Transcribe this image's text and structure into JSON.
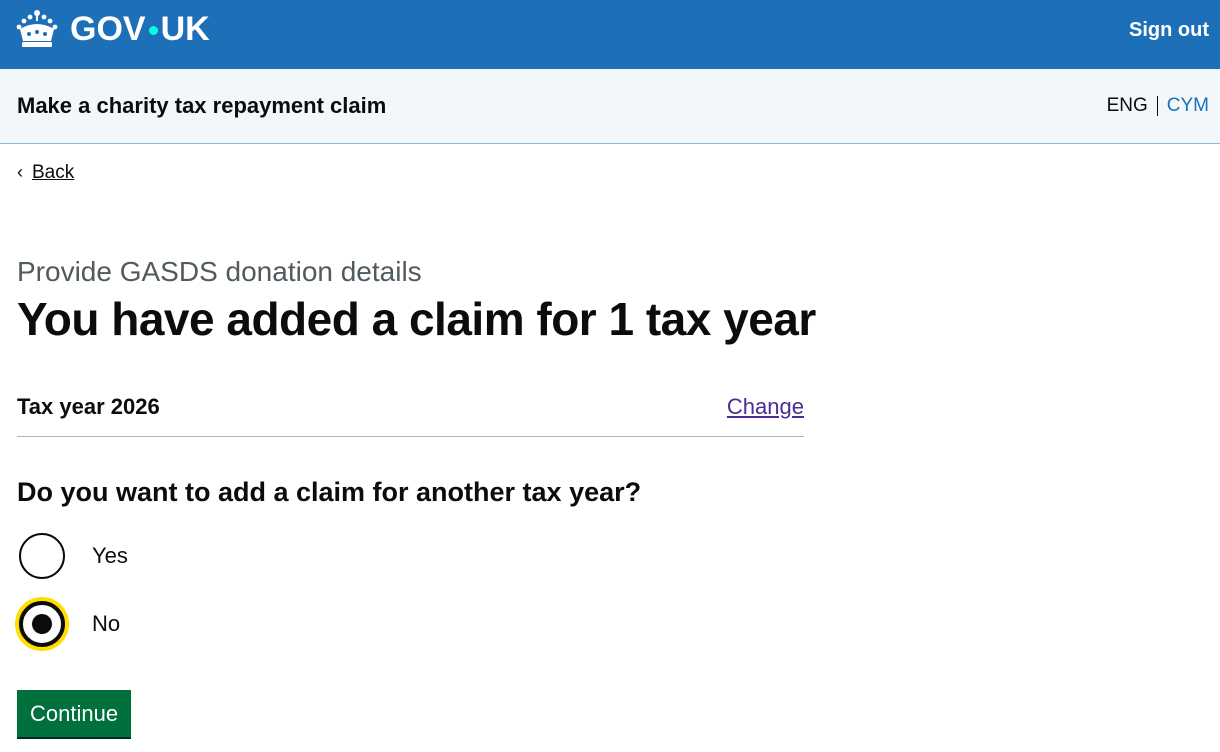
{
  "header": {
    "logo_text_left": "GOV",
    "logo_text_right": "UK",
    "sign_out": "Sign out",
    "brand_color": "#1d70b8"
  },
  "service": {
    "name": "Make a charity tax repayment claim",
    "lang_current": "ENG",
    "lang_other": "CYM"
  },
  "nav": {
    "back": "Back"
  },
  "page": {
    "caption": "Provide GASDS donation details",
    "heading": "You have added a claim for 1 tax year"
  },
  "summary": {
    "rows": [
      {
        "key": "Tax year 2026",
        "action": "Change"
      }
    ]
  },
  "question": {
    "legend": "Do you want to add a claim for another tax year?",
    "options": [
      {
        "label": "Yes",
        "checked": false
      },
      {
        "label": "No",
        "checked": true
      }
    ]
  },
  "actions": {
    "continue": "Continue",
    "button_color": "#00703c"
  },
  "focus_color": "#ffdd00"
}
